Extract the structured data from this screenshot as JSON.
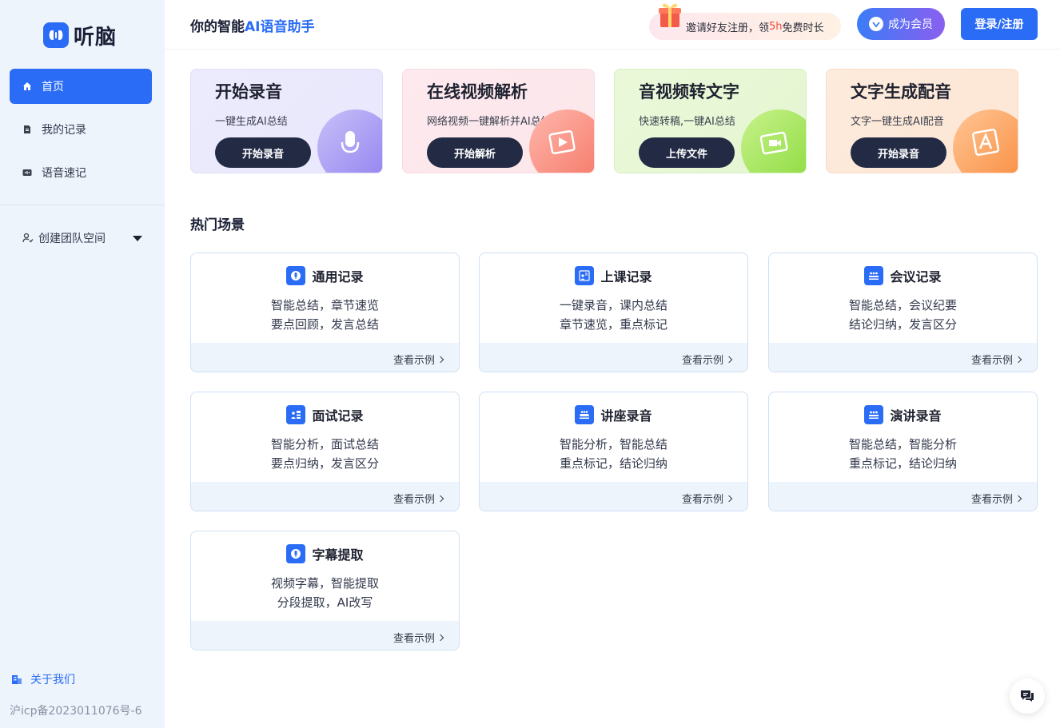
{
  "app": {
    "logo_text": "听脑"
  },
  "sidebar": {
    "items": [
      {
        "label": "首页",
        "icon": "home-icon",
        "active": true
      },
      {
        "label": "我的记录",
        "icon": "document-icon",
        "active": false
      },
      {
        "label": "语音速记",
        "icon": "voice-note-icon",
        "active": false
      }
    ],
    "team_label": "创建团队空间",
    "about_label": "关于我们",
    "icp": "沪icp备2023011076号-6"
  },
  "header": {
    "slogan_prefix": "你的智能",
    "slogan_highlight": "AI语音助手",
    "invite_pre": "邀请好友注册，领",
    "invite_red": "5h",
    "invite_post": "免费时长",
    "vip_label": "成为会员",
    "login_label": "登录/注册"
  },
  "features": [
    {
      "title": "开始录音",
      "desc": "一键生成AI总结",
      "button": "开始录音",
      "icon": "microphone-icon"
    },
    {
      "title": "在线视频解析",
      "desc": "网络视频一键解析并AI总结",
      "button": "开始解析",
      "icon": "play-icon"
    },
    {
      "title": "音视频转文字",
      "desc": "快速转稿,一键AI总结",
      "button": "上传文件",
      "icon": "video-camera-icon"
    },
    {
      "title": "文字生成配音",
      "desc": "文字一键生成AI配音",
      "button": "开始录音",
      "icon": "text-a-icon"
    }
  ],
  "hot": {
    "title": "热门场景",
    "link_label": "查看示例",
    "scenes": [
      {
        "title": "通用记录",
        "line1": "智能总结，章节速览",
        "line2": "要点回顾，发言总结",
        "icon": "mic-badge-icon"
      },
      {
        "title": "上课记录",
        "line1": "一键录音，课内总结",
        "line2": "章节速览，重点标记",
        "icon": "classroom-icon"
      },
      {
        "title": "会议记录",
        "line1": "智能总结，会议纪要",
        "line2": "结论归纳，发言区分",
        "icon": "meeting-icon"
      },
      {
        "title": "面试记录",
        "line1": "智能分析，面试总结",
        "line2": "要点归纳，发言区分",
        "icon": "interview-icon"
      },
      {
        "title": "讲座录音",
        "line1": "智能分析，智能总结",
        "line2": "重点标记，结论归纳",
        "icon": "lecture-icon"
      },
      {
        "title": "演讲录音",
        "line1": "智能总结，智能分析",
        "line2": "重点标记，结论归纳",
        "icon": "speech-icon"
      },
      {
        "title": "字幕提取",
        "line1": "视频字幕，智能提取",
        "line2": "分段提取，AI改写",
        "icon": "subtitle-icon"
      }
    ]
  },
  "colors": {
    "primary": "#2a6cf5",
    "sidebar_bg": "#eef4fc",
    "dark_button": "#222a44"
  }
}
